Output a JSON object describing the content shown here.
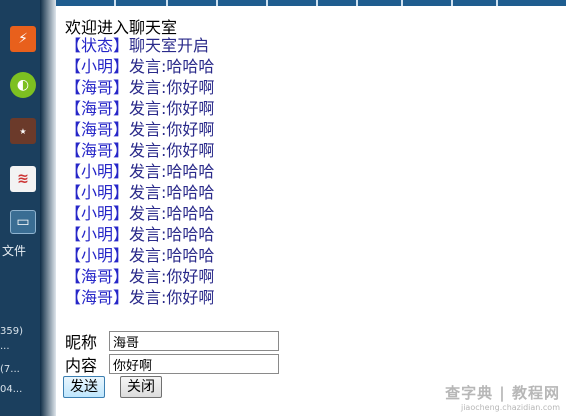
{
  "chat": {
    "welcome": "欢迎进入聊天室",
    "messages": [
      {
        "name": "【状态】",
        "verb": "聊天室开启",
        "text": ""
      },
      {
        "name": "【小明】",
        "verb": "发言:",
        "text": "哈哈哈"
      },
      {
        "name": "【海哥】",
        "verb": "发言:",
        "text": "你好啊"
      },
      {
        "name": "【海哥】",
        "verb": "发言:",
        "text": "你好啊"
      },
      {
        "name": "【海哥】",
        "verb": "发言:",
        "text": "你好啊"
      },
      {
        "name": "【海哥】",
        "verb": "发言:",
        "text": "你好啊"
      },
      {
        "name": "【小明】",
        "verb": "发言:",
        "text": "哈哈哈"
      },
      {
        "name": "【小明】",
        "verb": "发言:",
        "text": "哈哈哈"
      },
      {
        "name": "【小明】",
        "verb": "发言:",
        "text": "哈哈哈"
      },
      {
        "name": "【小明】",
        "verb": "发言:",
        "text": "哈哈哈"
      },
      {
        "name": "【小明】",
        "verb": "发言:",
        "text": "哈哈哈"
      },
      {
        "name": "【海哥】",
        "verb": "发言:",
        "text": "你好啊"
      },
      {
        "name": "【海哥】",
        "verb": "发言:",
        "text": "你好啊"
      }
    ]
  },
  "form": {
    "nickname_label": "昵称",
    "nickname_value": "海哥",
    "content_label": "内容",
    "content_value": "你好啊",
    "send_label": "发送",
    "close_label": "关闭"
  },
  "desktop": {
    "label": "文件",
    "texts": [
      "359)",
      "···",
      "(7...",
      "04..."
    ]
  },
  "watermark": {
    "main": "查字典 | 教程网",
    "sub": "jiaocheng.chazidian.com"
  },
  "colors": {
    "name": "#2626c8",
    "message": "#2a2a8a",
    "desktop": "#1b3f5e"
  }
}
